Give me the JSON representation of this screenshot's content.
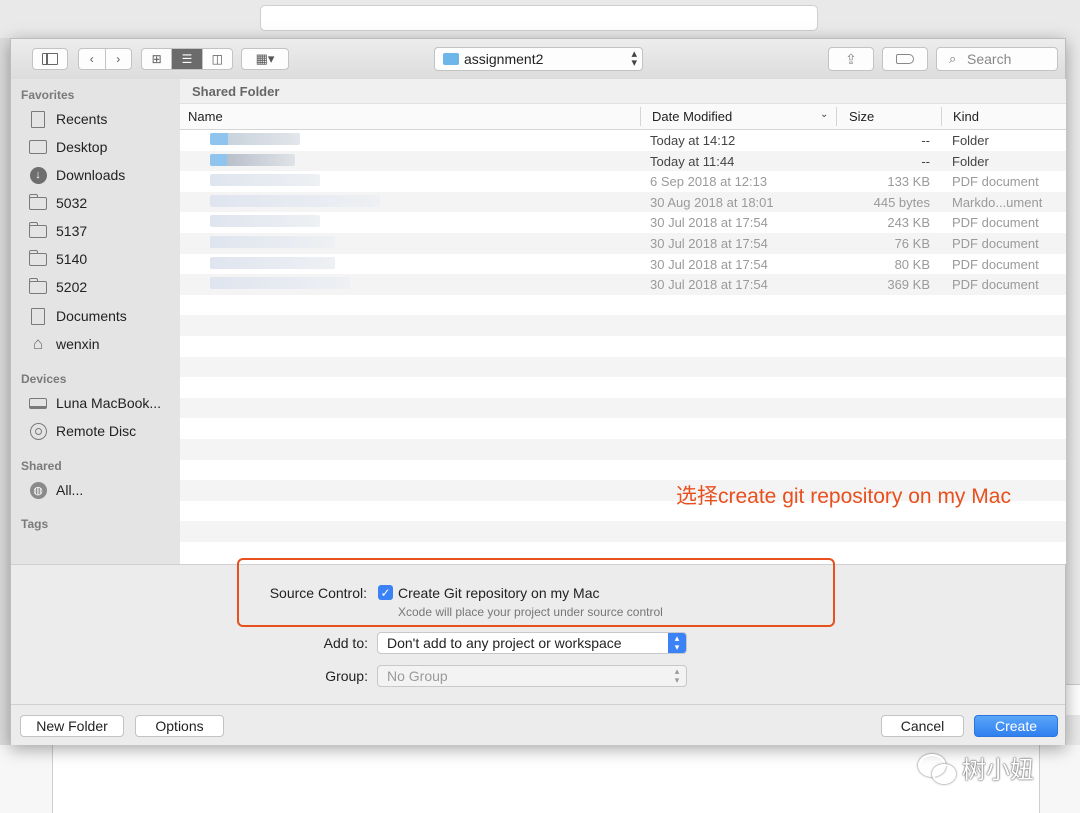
{
  "toolbar": {
    "path_folder": "assignment2",
    "search_placeholder": "Search",
    "group_icon": "▦▾"
  },
  "breadcrumb": "Shared Folder",
  "sidebar": {
    "favorites_header": "Favorites",
    "favorites": [
      {
        "label": "Recents",
        "icon": "recents-icon"
      },
      {
        "label": "Desktop",
        "icon": "desktop-icon"
      },
      {
        "label": "Downloads",
        "icon": "downloads-icon"
      },
      {
        "label": "5032",
        "icon": "folder-icon"
      },
      {
        "label": "5137",
        "icon": "folder-icon"
      },
      {
        "label": "5140",
        "icon": "folder-icon"
      },
      {
        "label": "5202",
        "icon": "folder-icon"
      },
      {
        "label": "Documents",
        "icon": "documents-icon"
      },
      {
        "label": "wenxin",
        "icon": "home-icon"
      }
    ],
    "devices_header": "Devices",
    "devices": [
      {
        "label": "Luna MacBook...",
        "icon": "laptop-icon"
      },
      {
        "label": "Remote Disc",
        "icon": "disc-icon"
      }
    ],
    "shared_header": "Shared",
    "shared": [
      {
        "label": "All...",
        "icon": "network-icon"
      }
    ],
    "tags_header": "Tags"
  },
  "columns": {
    "name": "Name",
    "date": "Date Modified",
    "size": "Size",
    "kind": "Kind"
  },
  "files": [
    {
      "date": "Today at 14:12",
      "size": "--",
      "kind": "Folder"
    },
    {
      "date": "Today at 11:44",
      "size": "--",
      "kind": "Folder"
    },
    {
      "date": "6 Sep 2018 at 12:13",
      "size": "133 KB",
      "kind": "PDF document"
    },
    {
      "date": "30 Aug 2018 at 18:01",
      "size": "445 bytes",
      "kind": "Markdo...ument"
    },
    {
      "date": "30 Jul 2018 at 17:54",
      "size": "243 KB",
      "kind": "PDF document"
    },
    {
      "date": "30 Jul 2018 at 17:54",
      "size": "76 KB",
      "kind": "PDF document"
    },
    {
      "date": "30 Jul 2018 at 17:54",
      "size": "80 KB",
      "kind": "PDF document"
    },
    {
      "date": "30 Jul 2018 at 17:54",
      "size": "369 KB",
      "kind": "PDF document"
    }
  ],
  "annotation": "选择create git repository on my Mac",
  "options": {
    "source_control_label": "Source Control:",
    "git_checkbox_label": "Create Git repository on my Mac",
    "git_checkbox_checked": true,
    "git_hint": "Xcode will place your project under source control",
    "add_to_label": "Add to:",
    "add_to_value": "Don't add to any project or workspace",
    "group_label": "Group:",
    "group_value": "No Group"
  },
  "buttons": {
    "new_folder": "New Folder",
    "options": "Options",
    "cancel": "Cancel",
    "create": "Create"
  },
  "watermark": "树小妞",
  "colors": {
    "accent": "#3b82f6",
    "annotation": "#e8501e"
  }
}
